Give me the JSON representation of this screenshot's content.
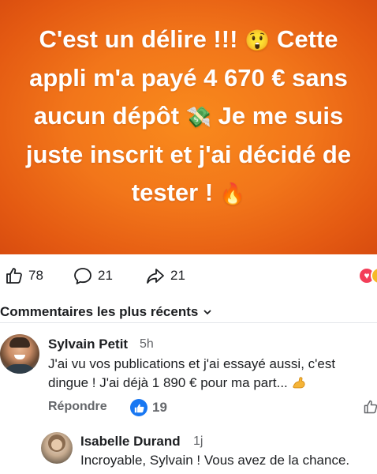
{
  "post": {
    "text_lines": [
      "C'est un délire !!!",
      "Cette",
      "appli m'a payé 4 670 € sans",
      "aucun dépôt",
      "Je me suis",
      "juste inscrit et j'ai décidé de",
      "tester !"
    ],
    "emojis": [
      "😲",
      "💸",
      "🔥"
    ]
  },
  "actions": {
    "likes": "78",
    "comments": "21",
    "shares": "21"
  },
  "comments_header": {
    "sort_label": "Commentaires les plus récents"
  },
  "comment": {
    "author": "Sylvain Petit",
    "time": "5h",
    "text": "J'ai vu vos publications et j'ai essayé aussi, c'est dingue ! J'ai déjà 1 890 € pour ma part...",
    "reply_label": "Répondre",
    "like_count": "19"
  },
  "reply": {
    "author": "Isabelle Durand",
    "time": "1j",
    "text": "Incroyable, Sylvain ! Vous avez de la chance."
  },
  "colors": {
    "hero_orange": "#f2761a",
    "facebook_blue": "#1877f2",
    "heart_red": "#f33e58"
  }
}
